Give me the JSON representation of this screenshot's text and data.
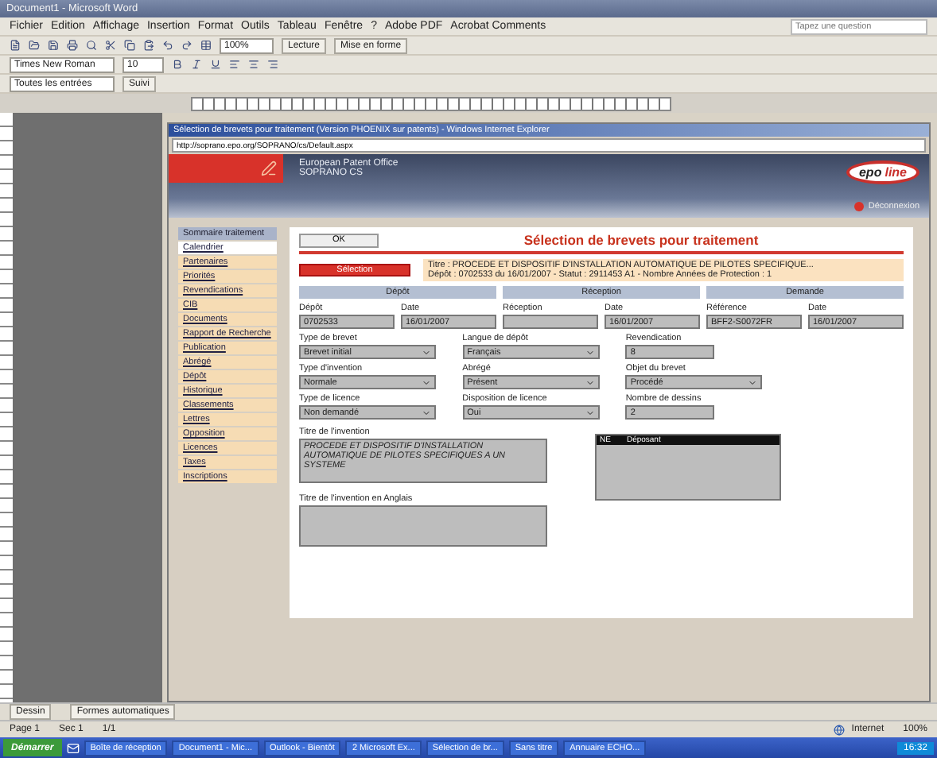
{
  "word": {
    "title": "Document1 - Microsoft Word",
    "menu": [
      "Fichier",
      "Edition",
      "Affichage",
      "Insertion",
      "Format",
      "Outils",
      "Tableau",
      "Fenêtre",
      "?",
      "Adobe PDF",
      "Acrobat Comments"
    ],
    "help_placeholder": "Tapez une question",
    "zoom": "100%",
    "toolbar_buttons": [
      "Lecture",
      "Mise en forme"
    ],
    "font": "Times New Roman",
    "size": "10",
    "review": [
      "Toutes les entrées",
      "Suivi"
    ],
    "draw_bar": [
      "Dessin",
      "Formes automatiques"
    ],
    "status": [
      "Page 1",
      "Sec 1",
      "1/1"
    ]
  },
  "browser": {
    "title": "Sélection de brevets pour traitement (Version PHOENIX sur patents) - Windows Internet Explorer",
    "address": "http://soprano.epo.org/SOPRANO/cs/Default.aspx",
    "org": "European Patent Office",
    "app": "SOPRANO CS",
    "logo": [
      "epo",
      "line"
    ],
    "logout": "Déconnexion",
    "status": [
      "Internet",
      "100%"
    ]
  },
  "sidebar": {
    "header": "Sommaire traitement",
    "items": [
      {
        "label": "Calendrier",
        "selected": true
      },
      {
        "label": "Partenaires",
        "selected": false
      },
      {
        "label": "Priorités",
        "selected": false
      },
      {
        "label": "Revendications",
        "selected": false
      },
      {
        "label": "CIB",
        "selected": false
      },
      {
        "label": "Documents",
        "selected": false
      },
      {
        "label": "Rapport de Recherche",
        "selected": false
      },
      {
        "label": "Publication",
        "selected": false
      },
      {
        "label": "Abrégé",
        "selected": false
      },
      {
        "label": "Dépôt",
        "selected": false
      },
      {
        "label": "Historique",
        "selected": false
      },
      {
        "label": "Classements",
        "selected": false
      },
      {
        "label": "Lettres",
        "selected": false
      },
      {
        "label": "Opposition",
        "selected": false
      },
      {
        "label": "Licences",
        "selected": false
      },
      {
        "label": "Taxes",
        "selected": false
      },
      {
        "label": "Inscriptions",
        "selected": false
      }
    ]
  },
  "main": {
    "ok": "OK",
    "heading": "Sélection de brevets pour traitement",
    "action": "Sélection",
    "summary": [
      "Titre : PROCEDE ET DISPOSITIF D'INSTALLATION AUTOMATIQUE DE PILOTES SPECIFIQUE...",
      "Dépôt : 0702533 du 16/01/2007 - Statut : 2911453 A1 - Nombre Années de Protection : 1"
    ],
    "sections": [
      "Dépôt",
      "Réception",
      "Demande"
    ],
    "top_fields": [
      {
        "label": "Dépôt",
        "value": "0702533"
      },
      {
        "label": "Date",
        "value": "16/01/2007"
      },
      {
        "label": "Réception"
      },
      {
        "label": "Date",
        "value": "16/01/2007"
      },
      {
        "label": "Référence",
        "value": "BFF2-S0072FR"
      },
      {
        "label": "Date",
        "value": "16/01/2007"
      }
    ],
    "rows": [
      [
        {
          "label": "Type de brevet",
          "value": "Brevet initial",
          "kind": "select"
        },
        {
          "label": "Langue de dépôt",
          "value": "Français",
          "kind": "select"
        },
        {
          "label": "Revendication",
          "value": "8",
          "kind": "text"
        }
      ],
      [
        {
          "label": "Type d'invention",
          "value": "Normale",
          "kind": "select"
        },
        {
          "label": "Abrégé",
          "value": "Présent",
          "kind": "select"
        },
        {
          "label": "Objet du brevet",
          "value": "Procédé",
          "kind": "select"
        }
      ],
      [
        {
          "label": "Type de licence",
          "value": "Non demandé",
          "kind": "select"
        },
        {
          "label": "Disposition de licence",
          "value": "Oui",
          "kind": "select"
        },
        {
          "label": "Nombre de dessins",
          "value": "2",
          "kind": "text"
        }
      ]
    ],
    "title_label": "Titre de l'invention",
    "title_value": "PROCEDE ET DISPOSITIF D'INSTALLATION AUTOMATIQUE DE PILOTES SPECIFIQUES A UN SYSTEME",
    "title_en_label": "Titre de l'invention en Anglais",
    "list_columns": [
      "NE",
      "Déposant"
    ]
  },
  "taskbar": {
    "start": "Démarrer",
    "tasks": [
      "Boîte de réception",
      "Document1 - Mic...",
      "Outlook - Bientôt",
      "2 Microsoft Ex...",
      "Sélection de br...",
      "Sans titre",
      "Annuaire ECHO..."
    ],
    "clock": "16:32"
  }
}
